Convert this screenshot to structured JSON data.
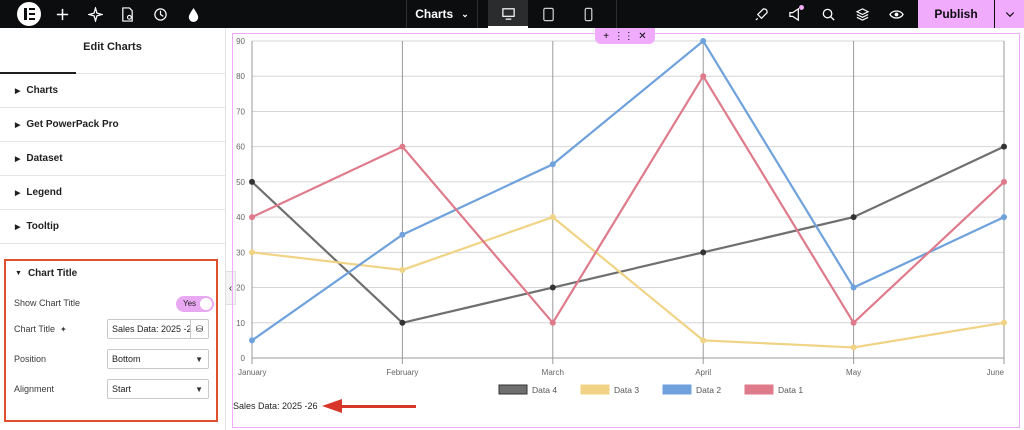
{
  "topbar": {
    "doc_title": "Charts",
    "publish_label": "Publish"
  },
  "panel": {
    "title": "Edit Charts",
    "sections": [
      "Charts",
      "Get PowerPack Pro",
      "Dataset",
      "Legend",
      "Tooltip"
    ],
    "chart_title_section": {
      "label": "Chart Title",
      "show_label": "Show Chart Title",
      "show_value": "Yes",
      "title_label": "Chart Title",
      "title_value": "Sales Data: 2025 -2",
      "position_label": "Position",
      "position_value": "Bottom",
      "alignment_label": "Alignment",
      "alignment_value": "Start"
    }
  },
  "canvas": {
    "caption": "Sales Data: 2025 -26"
  },
  "colors": {
    "accent": "#f0abfc",
    "annotation": "#d7372b"
  },
  "chart_data": {
    "type": "line",
    "categories": [
      "January",
      "February",
      "March",
      "April",
      "May",
      "June"
    ],
    "ylim": [
      0,
      90
    ],
    "yticks": [
      0,
      10,
      20,
      30,
      40,
      50,
      60,
      70,
      80,
      90
    ],
    "grid": true,
    "legend_position": "bottom",
    "series": [
      {
        "name": "Data 4",
        "color": "#6f6f6f",
        "values": [
          50,
          10,
          20,
          30,
          40,
          60
        ]
      },
      {
        "name": "Data 3",
        "color": "#f0d384",
        "values": [
          30,
          25,
          40,
          5,
          3,
          10
        ]
      },
      {
        "name": "Data 2",
        "color": "#6fa2dc",
        "values": [
          5,
          35,
          55,
          90,
          20,
          40
        ]
      },
      {
        "name": "Data 1",
        "color": "#df7a8a",
        "values": [
          40,
          60,
          10,
          80,
          10,
          50
        ]
      }
    ]
  }
}
